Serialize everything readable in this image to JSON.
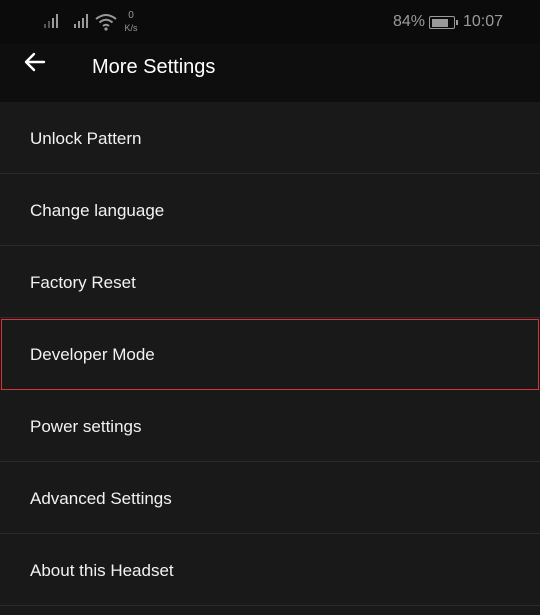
{
  "status": {
    "speed_value": "0",
    "speed_unit": "K/s",
    "battery_percent": "84%",
    "battery_level": 0.84,
    "time": "10:07"
  },
  "header": {
    "back_icon": "arrow-left-icon",
    "title": "More Settings"
  },
  "settings": {
    "items": [
      {
        "label": "Unlock Pattern"
      },
      {
        "label": "Change language"
      },
      {
        "label": "Factory Reset"
      },
      {
        "label": "Developer Mode",
        "highlighted": true
      },
      {
        "label": "Power settings"
      },
      {
        "label": "Advanced Settings"
      },
      {
        "label": "About this Headset"
      }
    ]
  },
  "colors": {
    "background": "#191919",
    "highlight_border": "#d6333b"
  }
}
